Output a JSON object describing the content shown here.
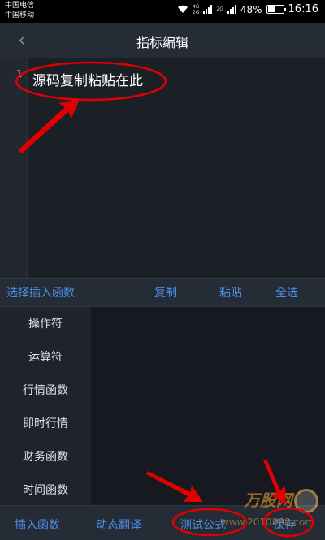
{
  "status_bar": {
    "carrier1": "中国电信",
    "carrier2": "中国移动",
    "network_tag_top": "4G",
    "network_tag_bottom": "2G",
    "network_tag_2": "2G",
    "battery_percent": "48%",
    "battery_level": 0.48,
    "time": "16:16"
  },
  "nav": {
    "back_icon": "chevron-left-icon",
    "title": "指标编辑"
  },
  "editor": {
    "line_number": "1",
    "content": "源码复制粘贴在此"
  },
  "actions": {
    "insert_function": "选择插入函数",
    "copy": "复制",
    "paste": "粘贴",
    "select_all": "全选"
  },
  "categories": [
    "操作符",
    "运算符",
    "行情函数",
    "即时行情",
    "财务函数",
    "时间函数"
  ],
  "bottom_bar": {
    "insert_function": "插入函数",
    "dynamic_translate": "动态翻译",
    "test_formula": "测试公式",
    "save": "保存"
  },
  "watermark": {
    "title": "万股网",
    "url": "www.2010888.com"
  },
  "colors": {
    "accent": "#4a8ee6",
    "annotation": "#e00000",
    "background": "#1d2128"
  }
}
